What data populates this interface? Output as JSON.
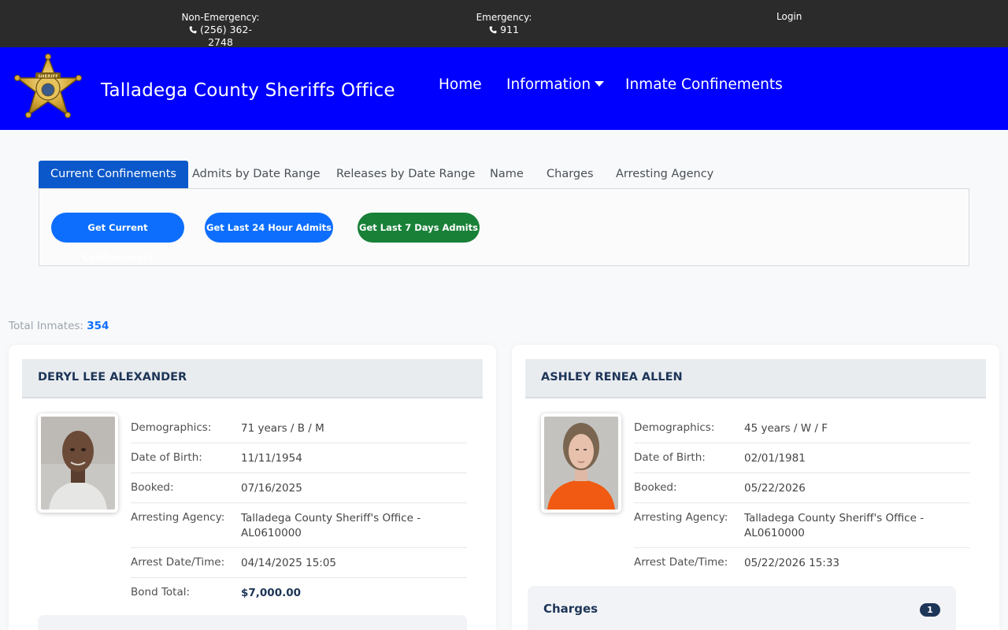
{
  "topbar": {
    "non_emergency_label": "Non-Emergency:",
    "non_emergency_phone": "(256) 362-2748",
    "emergency_label": "Emergency:",
    "emergency_phone": "911",
    "login_label": "Login"
  },
  "header": {
    "site_title": "Talladega County Sheriffs Office",
    "badge_text": "SHERIFF",
    "nav": {
      "home": "Home",
      "information": "Information",
      "inmate_confinements": "Inmate Confinements"
    }
  },
  "tabs": [
    {
      "label": "Current Confinements",
      "active": true
    },
    {
      "label": "Admits by Date Range",
      "active": false
    },
    {
      "label": "Releases by Date Range",
      "active": false
    },
    {
      "label": "Name",
      "active": false
    },
    {
      "label": "Charges",
      "active": false
    },
    {
      "label": "Arresting Agency",
      "active": false
    }
  ],
  "actions": {
    "current": "Get Current Confinements",
    "last24": "Get Last 24 Hour Admits",
    "last7": "Get Last 7 Days Admits"
  },
  "summary": {
    "total_label": "Total Inmates:",
    "total_value": "354"
  },
  "labels": {
    "demographics": "Demographics:",
    "dob": "Date of Birth:",
    "booked": "Booked:",
    "agency": "Arresting Agency:",
    "arrest": "Arrest Date/Time:",
    "bond": "Bond Total:",
    "charges": "Charges"
  },
  "inmates": [
    {
      "name": "DERYL LEE ALEXANDER",
      "demographics": "71 years / B / M",
      "dob": "11/11/1954",
      "booked": "07/16/2025",
      "agency": "Talladega County Sheriff's Office - AL0610000",
      "arrest": "04/14/2025 15:05",
      "bond": "$7,000.00"
    },
    {
      "name": "ASHLEY RENEA ALLEN",
      "demographics": "45 years / W / F",
      "dob": "02/01/1981",
      "booked": "05/22/2026",
      "agency": "Talladega County Sheriff's Office - AL0610000",
      "arrest": "05/22/2026 15:33",
      "charges_count": "1"
    }
  ],
  "colors": {
    "topbar": "#2b2b2b",
    "header": "#0000fe",
    "primary": "#0d6efd",
    "success": "#198038",
    "navy": "#1d3557"
  }
}
